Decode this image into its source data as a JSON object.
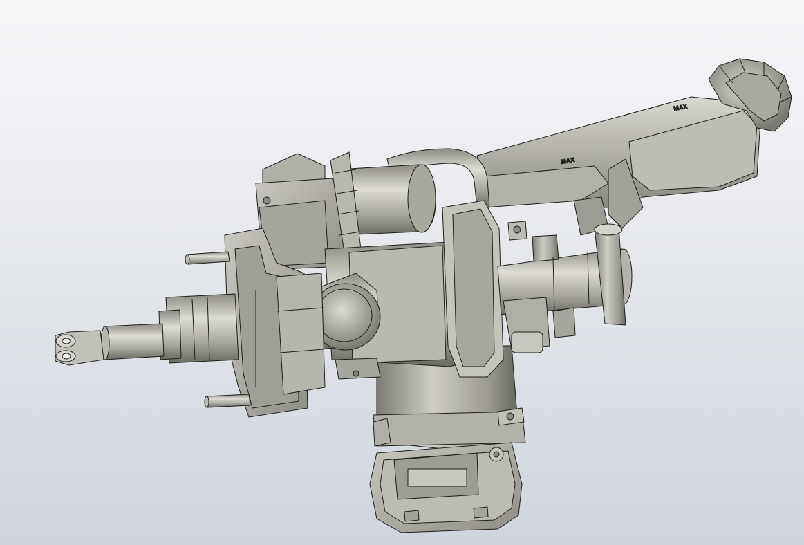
{
  "viewport": {
    "background_top": "#f6f7f9",
    "background_bottom": "#cfd4dc"
  },
  "model": {
    "metal_light": "#d2d1c9",
    "metal_mid": "#a9a89f",
    "metal_dark": "#6f6e66",
    "edge": "#1e1e1b",
    "engravings": [
      "MAX",
      "MAX"
    ]
  }
}
